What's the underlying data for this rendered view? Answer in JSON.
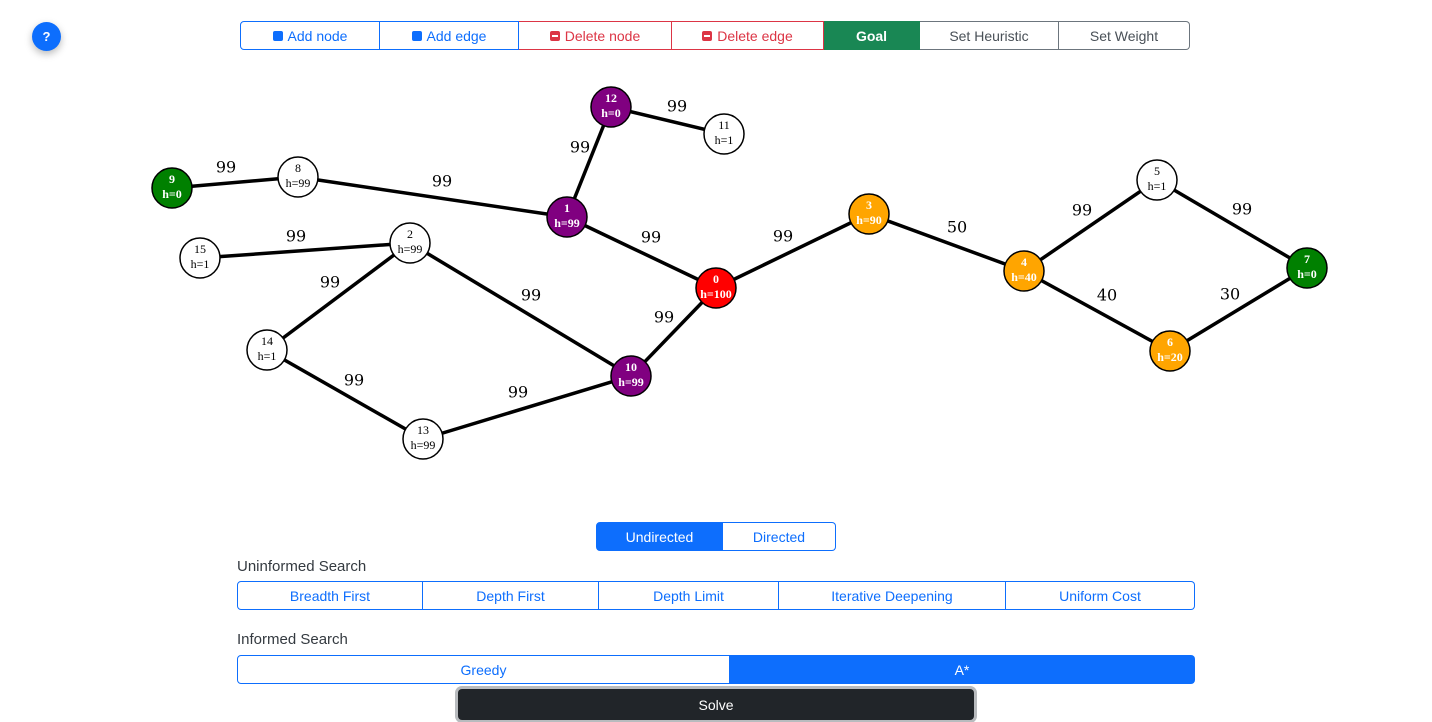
{
  "help": {
    "label": "?"
  },
  "toolbar": {
    "add_node": "Add node",
    "add_edge": "Add edge",
    "delete_node": "Delete node",
    "delete_edge": "Delete edge",
    "goal": "Goal",
    "set_heuristic": "Set Heuristic",
    "set_weight": "Set Weight"
  },
  "colors": {
    "red": "#ff0000",
    "purple": "#800080",
    "orange": "#ffa500",
    "green": "#008000",
    "white": "#ffffff"
  },
  "graph": {
    "nodes": [
      {
        "id": "0",
        "h": "h=100",
        "color": "red"
      },
      {
        "id": "1",
        "h": "h=99",
        "color": "purple"
      },
      {
        "id": "2",
        "h": "h=99",
        "color": "white"
      },
      {
        "id": "3",
        "h": "h=90",
        "color": "orange"
      },
      {
        "id": "4",
        "h": "h=40",
        "color": "orange"
      },
      {
        "id": "5",
        "h": "h=1",
        "color": "white"
      },
      {
        "id": "6",
        "h": "h=20",
        "color": "orange"
      },
      {
        "id": "7",
        "h": "h=0",
        "color": "green"
      },
      {
        "id": "8",
        "h": "h=99",
        "color": "white"
      },
      {
        "id": "9",
        "h": "h=0",
        "color": "green"
      },
      {
        "id": "10",
        "h": "h=99",
        "color": "purple"
      },
      {
        "id": "11",
        "h": "h=1",
        "color": "white"
      },
      {
        "id": "12",
        "h": "h=0",
        "color": "purple"
      },
      {
        "id": "13",
        "h": "h=99",
        "color": "white"
      },
      {
        "id": "14",
        "h": "h=1",
        "color": "white"
      },
      {
        "id": "15",
        "h": "h=1",
        "color": "white"
      }
    ],
    "edges": [
      {
        "from": "9",
        "to": "8",
        "weight": "99"
      },
      {
        "from": "8",
        "to": "1",
        "weight": "99"
      },
      {
        "from": "12",
        "to": "11",
        "weight": "99"
      },
      {
        "from": "12",
        "to": "1",
        "weight": "99"
      },
      {
        "from": "1",
        "to": "0",
        "weight": "99"
      },
      {
        "from": "15",
        "to": "2",
        "weight": "99"
      },
      {
        "from": "2",
        "to": "14",
        "weight": "99"
      },
      {
        "from": "2",
        "to": "10",
        "weight": "99"
      },
      {
        "from": "14",
        "to": "13",
        "weight": "99"
      },
      {
        "from": "13",
        "to": "10",
        "weight": "99"
      },
      {
        "from": "10",
        "to": "0",
        "weight": "99"
      },
      {
        "from": "0",
        "to": "3",
        "weight": "99"
      },
      {
        "from": "3",
        "to": "4",
        "weight": "50"
      },
      {
        "from": "4",
        "to": "5",
        "weight": "99"
      },
      {
        "from": "5",
        "to": "7",
        "weight": "99"
      },
      {
        "from": "4",
        "to": "6",
        "weight": "40"
      },
      {
        "from": "6",
        "to": "7",
        "weight": "30"
      }
    ]
  },
  "direction": {
    "undirected": "Undirected",
    "directed": "Directed",
    "selected": "Undirected"
  },
  "uninformed": {
    "title": "Uninformed Search",
    "bfs": "Breadth First",
    "dfs": "Depth First",
    "dls": "Depth Limit",
    "ids": "Iterative Deepening",
    "ucs": "Uniform Cost"
  },
  "informed": {
    "title": "Informed Search",
    "greedy": "Greedy",
    "astar": "A*",
    "selected": "A*"
  },
  "solve": {
    "label": "Solve"
  }
}
